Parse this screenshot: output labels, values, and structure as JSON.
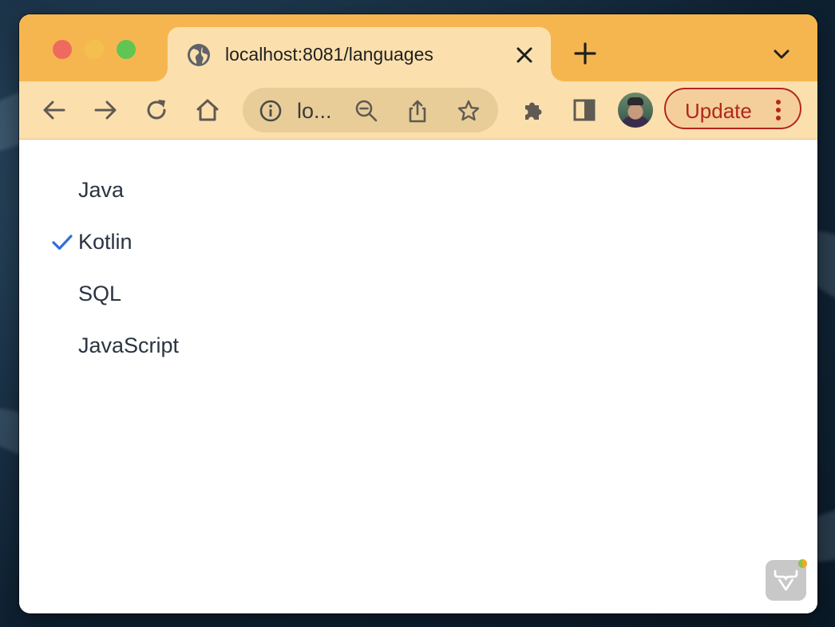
{
  "browser": {
    "tab": {
      "title": "localhost:8081/languages",
      "favicon": "globe-icon",
      "close_icon": "close-icon"
    },
    "new_tab_icon": "plus-icon",
    "tab_menu_icon": "chevron-down-icon",
    "toolbar": {
      "back_icon": "arrow-left-icon",
      "forward_icon": "arrow-right-icon",
      "reload_icon": "reload-icon",
      "home_icon": "home-icon",
      "omnibox": {
        "info_icon": "info-icon",
        "url_text": "lo...",
        "zoom_icon": "zoom-out-icon",
        "share_icon": "share-icon",
        "bookmark_icon": "star-icon"
      },
      "extensions_icon": "puzzle-icon",
      "side_panel_icon": "side-panel-icon",
      "update_label": "Update",
      "menu_icon": "more-vertical-icon"
    },
    "colors": {
      "frame": "#f6b64f",
      "toolbar": "#fbe0ae",
      "update": "#b3261e",
      "check": "#2f6fd6"
    }
  },
  "page": {
    "languages": [
      {
        "label": "Java",
        "selected": false
      },
      {
        "label": "Kotlin",
        "selected": true
      },
      {
        "label": "SQL",
        "selected": false
      },
      {
        "label": "JavaScript",
        "selected": false
      }
    ],
    "dev_badge_icon": "vaadin-logo-icon"
  }
}
